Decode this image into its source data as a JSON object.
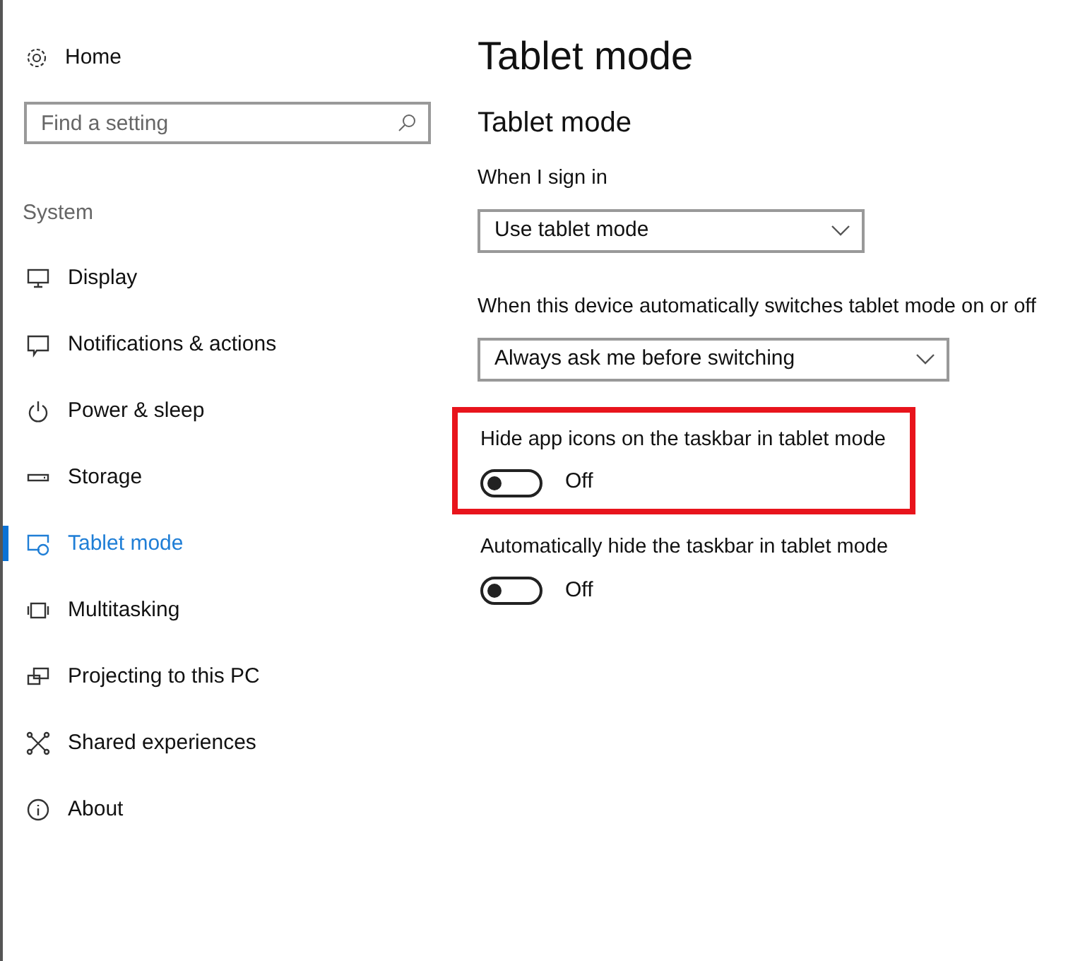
{
  "sidebar": {
    "home": "Home",
    "search": {
      "placeholder": "Find a setting"
    },
    "section": "System",
    "items": [
      {
        "label": "Display",
        "selected": false
      },
      {
        "label": "Notifications & actions",
        "selected": false
      },
      {
        "label": "Power & sleep",
        "selected": false
      },
      {
        "label": "Storage",
        "selected": false
      },
      {
        "label": "Tablet mode",
        "selected": true
      },
      {
        "label": "Multitasking",
        "selected": false
      },
      {
        "label": "Projecting to this PC",
        "selected": false
      },
      {
        "label": "Shared experiences",
        "selected": false
      },
      {
        "label": "About",
        "selected": false
      }
    ]
  },
  "page": {
    "title": "Tablet mode",
    "section": "Tablet mode",
    "dropdowns": [
      {
        "label": "When I sign in",
        "value": "Use tablet mode"
      },
      {
        "label": "When this device automatically switches tablet mode on or off",
        "value": "Always ask me before switching"
      }
    ],
    "toggles": [
      {
        "label": "Hide app icons on the taskbar in tablet mode",
        "on": false,
        "state": "Off",
        "highlighted": true
      },
      {
        "label": "Automatically hide the taskbar in tablet mode",
        "on": false,
        "state": "Off",
        "highlighted": false
      }
    ]
  }
}
